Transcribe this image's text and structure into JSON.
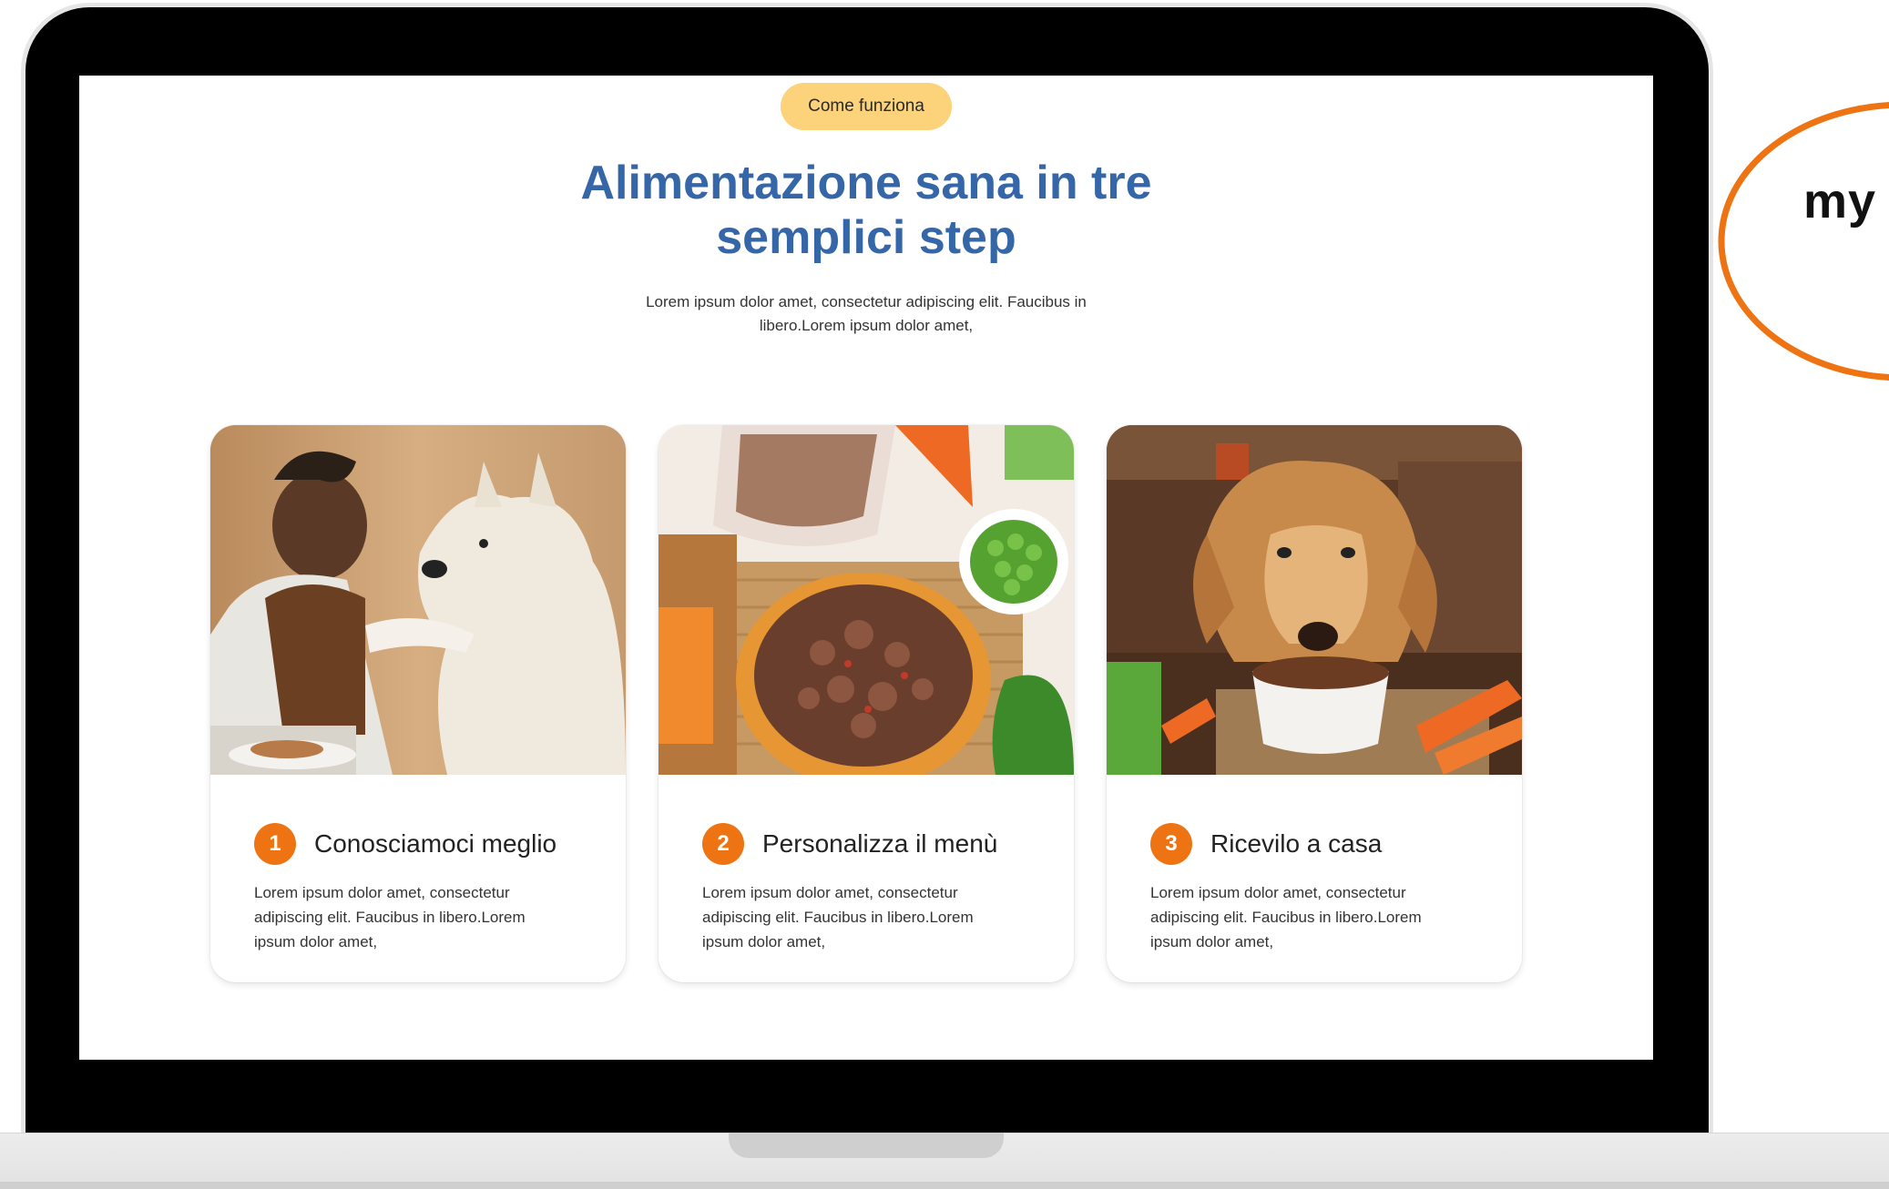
{
  "page": {
    "badge": "Come funziona",
    "title_line1": "Alimentazione sana in tre",
    "title_line2": "semplici step",
    "subtitle_line1": "Lorem ipsum dolor amet, consectetur adipiscing elit. Faucibus in",
    "subtitle_line2": "libero.Lorem ipsum dolor amet,"
  },
  "steps": [
    {
      "number": "1",
      "title": "Conosciamoci meglio",
      "text_line1": "Lorem ipsum dolor amet, consectetur",
      "text_line2": "adipiscing elit. Faucibus in libero.Lorem",
      "text_line3": "ipsum dolor amet,",
      "image": "man-with-dog-photo"
    },
    {
      "number": "2",
      "title": "Personalizza il menù",
      "text_line1": "Lorem ipsum dolor amet, consectetur",
      "text_line2": "adipiscing elit. Faucibus in libero.Lorem",
      "text_line3": "ipsum dolor amet,",
      "image": "dog-food-bowl-photo"
    },
    {
      "number": "3",
      "title": "Ricevilo a casa",
      "text_line1": "Lorem ipsum dolor amet, consectetur",
      "text_line2": "adipiscing elit. Faucibus in libero.Lorem",
      "text_line3": "ipsum dolor amet,",
      "image": "dog-eating-photo"
    }
  ],
  "logo": {
    "text": "my"
  },
  "colors": {
    "accent_orange": "#ee7413",
    "title_blue": "#3566a8",
    "badge_yellow": "#fcd27a",
    "laptop_bezel": "#000000"
  }
}
